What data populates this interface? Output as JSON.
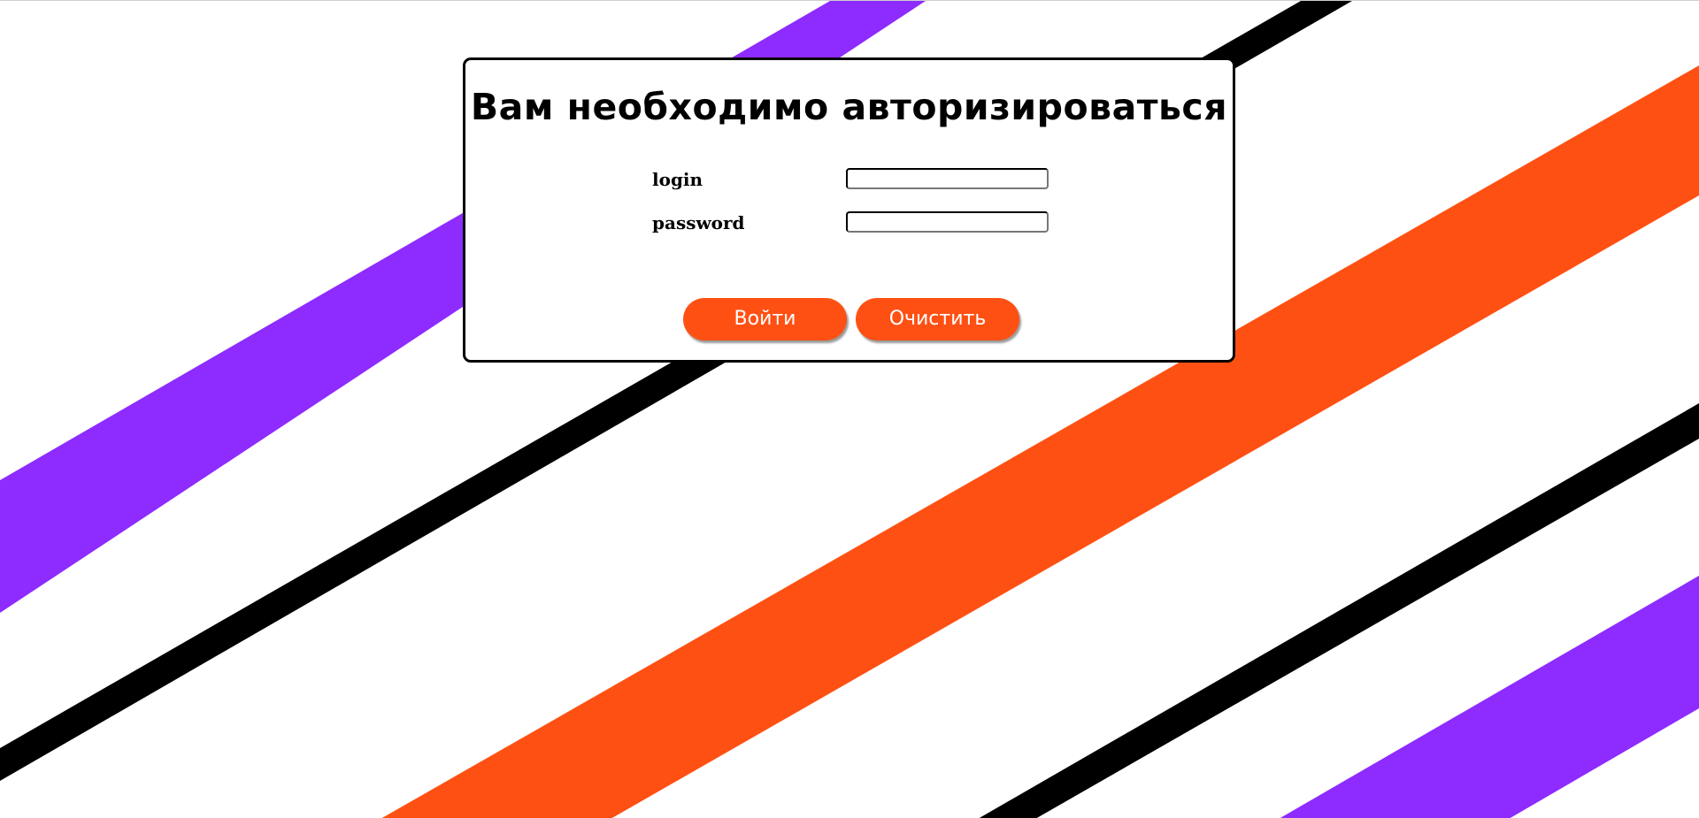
{
  "colors": {
    "purple_stripe": "#8e2bff",
    "orange_stripe": "#ff5014",
    "black_stripe": "#000000",
    "background": "#ffffff",
    "button": "#ff5014",
    "button_text": "#ffffff"
  },
  "login": {
    "title": "Вам необходимо авторизироваться",
    "login_label": "login",
    "login_value": "",
    "password_label": "password",
    "password_value": "",
    "submit_label": "Войти",
    "clear_label": "Очистить"
  }
}
